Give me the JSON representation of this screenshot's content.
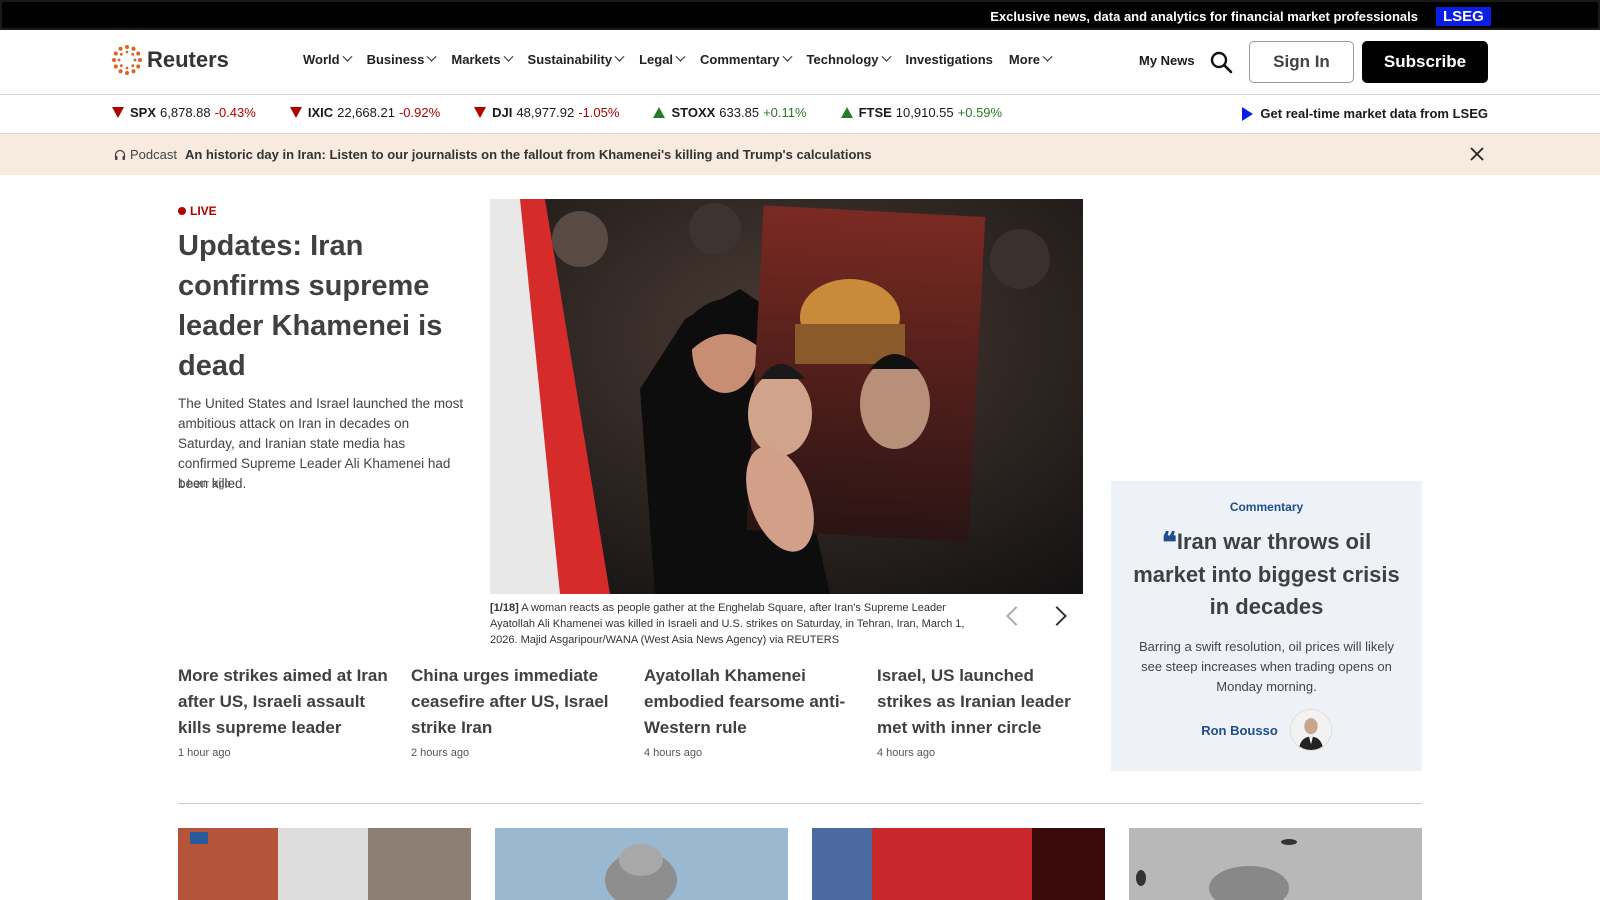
{
  "topbar": {
    "promo": "Exclusive news, data and analytics for financial market professionals",
    "lseg": "LSEG"
  },
  "header": {
    "logo_text": "Reuters",
    "nav": [
      {
        "label": "World",
        "has_menu": true
      },
      {
        "label": "Business",
        "has_menu": true
      },
      {
        "label": "Markets",
        "has_menu": true
      },
      {
        "label": "Sustainability",
        "has_menu": true
      },
      {
        "label": "Legal",
        "has_menu": true
      },
      {
        "label": "Commentary",
        "has_menu": true
      },
      {
        "label": "Technology",
        "has_menu": true
      },
      {
        "label": "Investigations",
        "has_menu": false
      },
      {
        "label": "More",
        "has_menu": true
      }
    ],
    "my_news": "My News",
    "sign_in": "Sign In",
    "subscribe": "Subscribe"
  },
  "ticker": {
    "items": [
      {
        "symbol": "SPX",
        "value": "6,878.88",
        "change": "-0.43%",
        "direction": "down"
      },
      {
        "symbol": "IXIC",
        "value": "22,668.21",
        "change": "-0.92%",
        "direction": "down"
      },
      {
        "symbol": "DJI",
        "value": "48,977.92",
        "change": "-1.05%",
        "direction": "down"
      },
      {
        "symbol": "STOXX",
        "value": "633.85",
        "change": "+0.11%",
        "direction": "up"
      },
      {
        "symbol": "FTSE",
        "value": "10,910.55",
        "change": "+0.59%",
        "direction": "up"
      }
    ],
    "lseg_link": "Get real-time market data from LSEG"
  },
  "podcast": {
    "label": "Podcast",
    "title": "An historic day in Iran: Listen to our journalists on the fallout from Khamenei's killing and Trump's calculations"
  },
  "lead": {
    "live": "LIVE",
    "headline": "Updates: Iran confirms supreme leader Khamenei is dead",
    "summary": "The United States and Israel launched the most ambitious attack on Iran in decades on Saturday, and Iranian state media has confirmed Supreme Leader Ali Khamenei had been killed.",
    "time": "1 hour ago",
    "caption_index": "[1/18]",
    "caption": "A woman reacts as people gather at the Enghelab Square, after Iran's Supreme Leader Ayatollah Ali Khamenei was killed in Israeli and U.S. strikes on Saturday, in Tehran, Iran, March 1, 2026. Majid Asgaripour/WANA (West Asia News Agency) via REUTERS"
  },
  "stories": [
    {
      "title": "More strikes aimed at Iran after US, Israeli assault kills supreme leader",
      "time": "1 hour ago"
    },
    {
      "title": "China urges immediate ceasefire after US, Israel strike Iran",
      "time": "2 hours ago"
    },
    {
      "title": "Ayatollah Khamenei embodied fearsome anti-Western rule",
      "time": "4 hours ago"
    },
    {
      "title": "Israel, US launched strikes as Iranian leader met with inner circle",
      "time": "4 hours ago"
    }
  ],
  "commentary": {
    "label": "Commentary",
    "title": "Iran war throws oil market into biggest crisis in decades",
    "desc": "Barring a swift resolution, oil prices will likely see steep increases when trading opens on Monday morning.",
    "author": "Ron Bousso"
  },
  "colors": {
    "lseg_blue": "#0a1ee6",
    "down_red": "#b00000",
    "up_green": "#2b7a2b",
    "commentary_blue": "#1f4e8c",
    "podcast_bg": "#f7ebe0",
    "commentary_bg": "#eef2f7"
  }
}
